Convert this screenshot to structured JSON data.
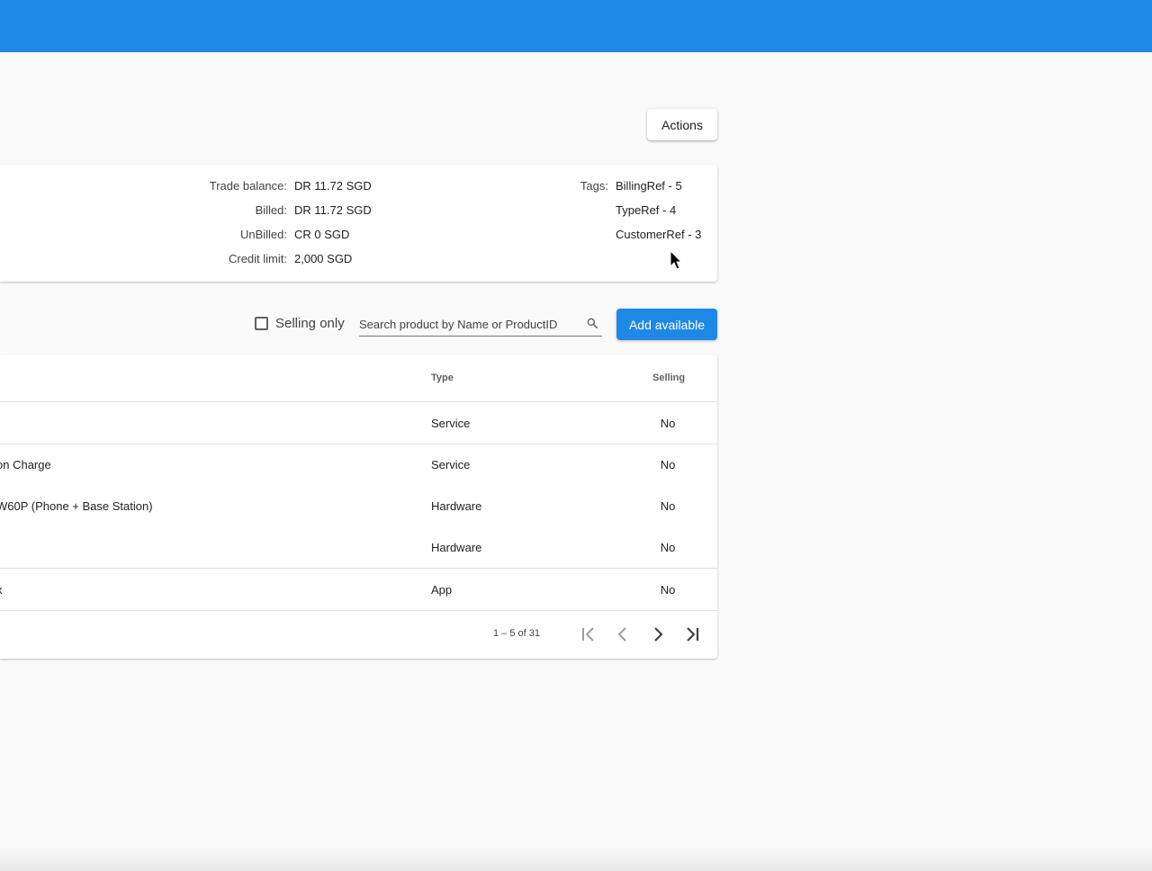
{
  "header": {
    "color": "#1e88e5"
  },
  "actions_button": {
    "label": "Actions"
  },
  "balance": {
    "rows": [
      {
        "label": "Trade balance:",
        "value": "DR 11.72 SGD"
      },
      {
        "label": "Billed:",
        "value": "DR 11.72 SGD"
      },
      {
        "label": "UnBilled:",
        "value": "CR 0 SGD"
      },
      {
        "label": "Credit limit:",
        "value": "2,000 SGD"
      }
    ]
  },
  "tags": {
    "label": "Tags:",
    "items": [
      "BillingRef - 5",
      "TypeRef - 4",
      "CustomerRef - 3"
    ]
  },
  "toolbar": {
    "selling_only_label": "Selling only",
    "search_placeholder": "Search product by Name or ProductID",
    "add_available_label": "Add available",
    "accent": "#1e88e5"
  },
  "table": {
    "columns": {
      "type": "Type",
      "selling": "Selling"
    },
    "rows": [
      {
        "name": "",
        "type": "Service",
        "selling": "No"
      },
      {
        "name": "on Charge",
        "type": "Service",
        "selling": "No"
      },
      {
        "name": "W60P (Phone + Base Station)",
        "type": "Hardware",
        "selling": "No"
      },
      {
        "name": "",
        "type": "Hardware",
        "selling": "No"
      },
      {
        "name": "x",
        "type": "App",
        "selling": "No"
      }
    ]
  },
  "pagination": {
    "range_text": "1 – 5 of 31",
    "icons": [
      "first-page-icon",
      "previous-page-icon",
      "next-page-icon",
      "last-page-icon"
    ]
  }
}
